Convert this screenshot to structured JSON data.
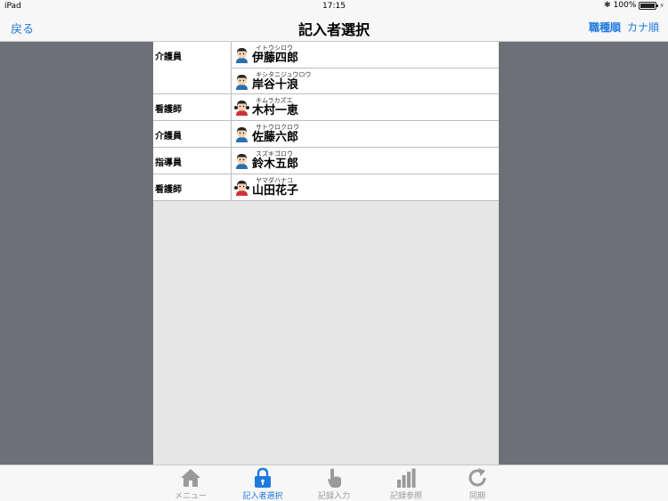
{
  "status": {
    "device": "iPad",
    "time": "17:15",
    "battery": "100%"
  },
  "nav": {
    "back": "戻る",
    "title": "記入者選択",
    "sort_role": "職種順",
    "sort_kana": "カナ順"
  },
  "groups": [
    {
      "role": "介護員",
      "people": [
        {
          "kana": "イトウシロウ",
          "name": "伊藤四郎",
          "gender": "male"
        },
        {
          "kana": "キシタニジュウロウ",
          "name": "岸谷十浪",
          "gender": "male"
        }
      ]
    },
    {
      "role": "看護師",
      "people": [
        {
          "kana": "キムラカズエ",
          "name": "木村一恵",
          "gender": "female"
        }
      ]
    },
    {
      "role": "介護員",
      "people": [
        {
          "kana": "サトウロクロウ",
          "name": "佐藤六郎",
          "gender": "male"
        }
      ]
    },
    {
      "role": "指導員",
      "people": [
        {
          "kana": "スズキゴロウ",
          "name": "鈴木五郎",
          "gender": "male"
        }
      ]
    },
    {
      "role": "看護師",
      "people": [
        {
          "kana": "ヤマダハナコ",
          "name": "山田花子",
          "gender": "female"
        }
      ]
    }
  ],
  "tabs": [
    {
      "label": "メニュー",
      "icon": "home-icon"
    },
    {
      "label": "記入者選択",
      "icon": "lock-icon"
    },
    {
      "label": "記録入力",
      "icon": "hand-pointer-icon"
    },
    {
      "label": "記録参照",
      "icon": "bar-chart-icon"
    },
    {
      "label": "同期",
      "icon": "sync-icon"
    }
  ],
  "colors": {
    "accent": "#1f7ae0",
    "background": "#6d7076",
    "panel": "#e6e6e6"
  }
}
